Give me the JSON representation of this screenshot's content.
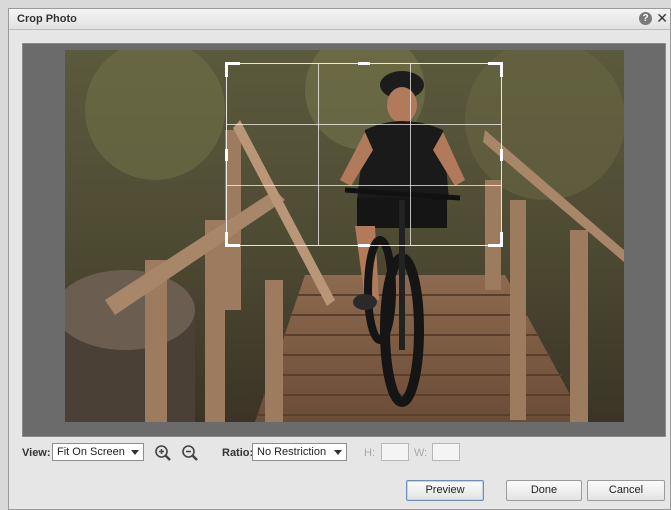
{
  "window": {
    "title": "Crop Photo",
    "help_glyph": "?",
    "close_glyph": "✕"
  },
  "controls": {
    "view_label": "View:",
    "view_value": "Fit On Screen",
    "ratio_label": "Ratio:",
    "ratio_value": "No Restriction",
    "height_label": "H:",
    "width_label": "W:",
    "height_value": "",
    "width_value": ""
  },
  "buttons": {
    "preview": "Preview",
    "done": "Done",
    "cancel": "Cancel"
  },
  "icons": [
    "zoom-in-icon",
    "zoom-out-icon",
    "help-icon",
    "close-icon"
  ],
  "colors": {
    "accent_border": "#6e8fb8",
    "canvas_bg": "#6b6b6b"
  }
}
